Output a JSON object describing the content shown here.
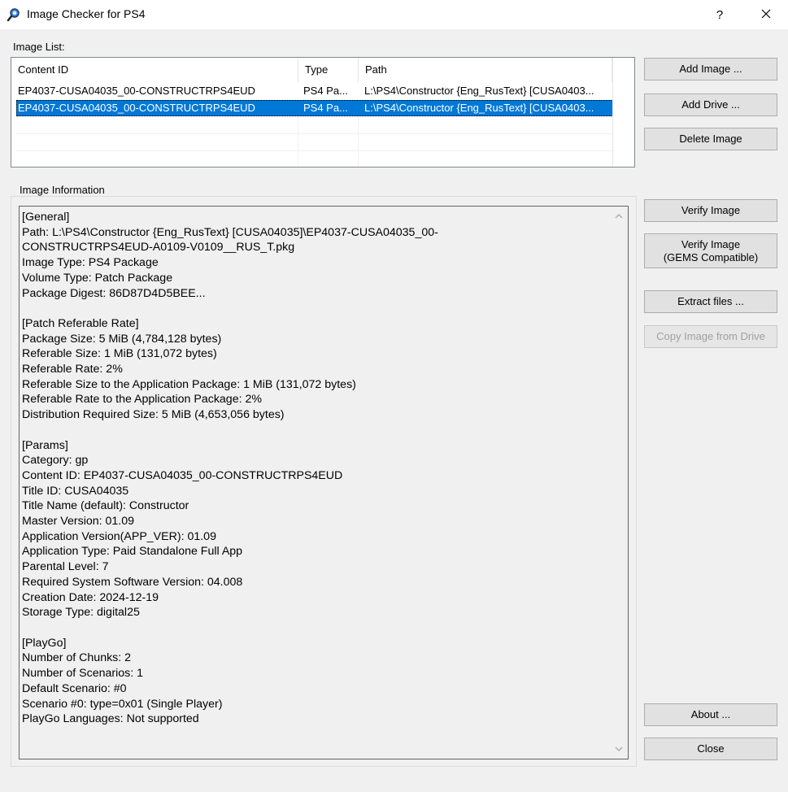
{
  "window": {
    "title": "Image Checker for PS4",
    "help": "?",
    "close": "✕"
  },
  "image_list": {
    "label": "Image List:",
    "columns": [
      "Content ID",
      "Type",
      "Path"
    ],
    "rows": [
      {
        "content_id": "EP4037-CUSA04035_00-CONSTRUCTRPS4EUD",
        "type": "PS4 Pa...",
        "path": "L:\\PS4\\Constructor {Eng_RusText} [CUSA0403...",
        "selected": false
      },
      {
        "content_id": "EP4037-CUSA04035_00-CONSTRUCTRPS4EUD",
        "type": "PS4 Pa...",
        "path": "L:\\PS4\\Constructor {Eng_RusText} [CUSA0403...",
        "selected": true
      }
    ]
  },
  "buttons": {
    "add_image": "Add Image ...",
    "add_drive": "Add Drive ...",
    "delete_image": "Delete Image",
    "verify_image": "Verify Image",
    "verify_gems_line1": "Verify Image",
    "verify_gems_line2": "(GEMS Compatible)",
    "extract_files": "Extract files ...",
    "copy_from_drive": "Copy Image from Drive",
    "about": "About ...",
    "close": "Close"
  },
  "image_info": {
    "label": "Image Information",
    "text": "[General]\nPath: L:\\PS4\\Constructor {Eng_RusText} [CUSA04035]\\EP4037-CUSA04035_00-\nCONSTRUCTRPS4EUD-A0109-V0109__RUS_T.pkg\nImage Type: PS4 Package\nVolume Type: Patch Package\nPackage Digest: 86D87D4D5BEE...\n\n[Patch Referable Rate]\nPackage Size: 5 MiB (4,784,128 bytes)\nReferable Size: 1 MiB (131,072 bytes)\nReferable Rate: 2%\nReferable Size to the Application Package: 1 MiB (131,072 bytes)\nReferable Rate to the Application Package: 2%\nDistribution Required Size: 5 MiB (4,653,056 bytes)\n\n[Params]\nCategory: gp\nContent ID: EP4037-CUSA04035_00-CONSTRUCTRPS4EUD\nTitle ID: CUSA04035\nTitle Name (default): Constructor\nMaster Version: 01.09\nApplication Version(APP_VER): 01.09\nApplication Type: Paid Standalone Full App\nParental Level: 7\nRequired System Software Version: 04.008\nCreation Date: 2024-12-19\nStorage Type: digital25\n\n[PlayGo]\nNumber of Chunks: 2\nNumber of Scenarios: 1\nDefault Scenario: #0\nScenario #0: type=0x01 (Single Player)\nPlayGo Languages: Not supported"
  },
  "colors": {
    "selection": "#0078d7",
    "window_bg": "#f0f0f0",
    "button_bg": "#e1e1e1"
  }
}
